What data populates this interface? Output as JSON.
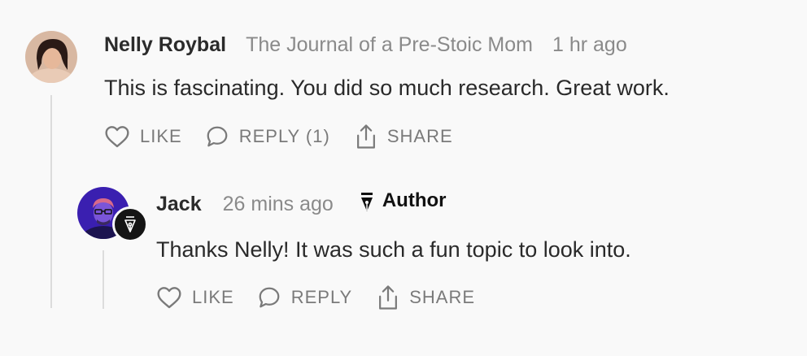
{
  "comments": [
    {
      "author": "Nelly Roybal",
      "publication": "The Journal of a Pre-Stoic Mom",
      "time": "1 hr ago",
      "text": "This is fascinating. You did so much research. Great work.",
      "actions": {
        "like": "LIKE",
        "reply": "REPLY (1)",
        "share": "SHARE"
      },
      "avatar_icon": "avatar-photo"
    },
    {
      "author": "Jack",
      "time": "26 mins ago",
      "role": "Author",
      "role_icon": "pen-nib-icon",
      "text": "Thanks Nelly! It was such a fun topic to look into.",
      "actions": {
        "like": "LIKE",
        "reply": "REPLY",
        "share": "SHARE"
      },
      "avatar_icon": "avatar-photo"
    }
  ],
  "colors": {
    "background": "#f9f9f9",
    "muted_text": "#8a8a8a",
    "action_text": "#7a7a7a",
    "thread_line": "#dcdcdc",
    "jack_avatar": "#3a1fb0"
  }
}
